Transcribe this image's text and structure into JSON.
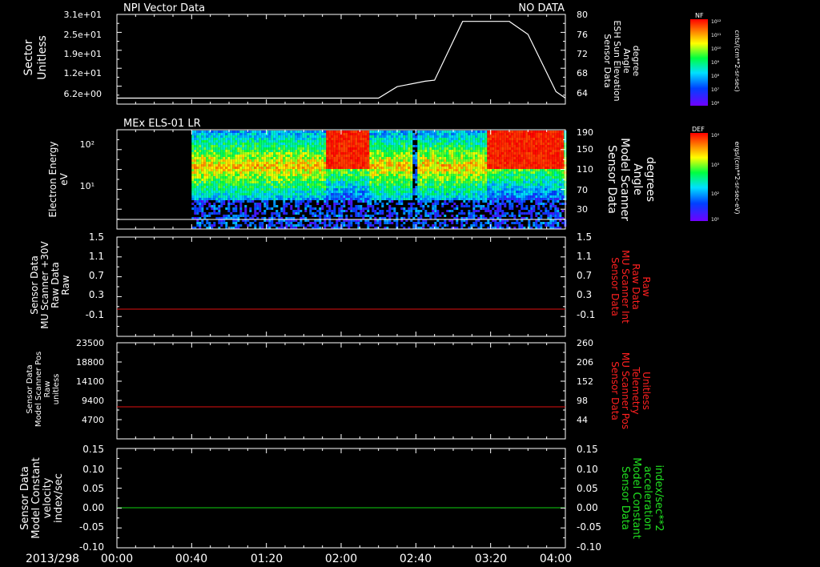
{
  "colors": {
    "axis": "#ffffff",
    "red_trace": "#e01010",
    "green_trace": "#10d010",
    "right_label_red": "#ff2020",
    "right_label_green": "#20e020"
  },
  "time_axis": {
    "start_label": "2013/298",
    "ticks": [
      "00:00",
      "00:40",
      "01:20",
      "02:00",
      "02:40",
      "03:20",
      "04:00"
    ]
  },
  "panels": {
    "p1": {
      "title": "NPI Vector Data",
      "status": "NO DATA",
      "left_label": [
        "Sector",
        "Unitless"
      ],
      "right_label": [
        "Sensor Data",
        "ESH Sun Elevation",
        "Angle",
        "degree"
      ],
      "left_ticks": [
        "3.1e+01",
        "2.5e+01",
        "1.9e+01",
        "1.2e+01",
        "6.2e+00"
      ],
      "right_ticks": [
        "80",
        "76",
        "72",
        "68",
        "64"
      ]
    },
    "p2": {
      "title": "MEx ELS-01 LR",
      "left_label": [
        "Electron Energy",
        "eV"
      ],
      "right_label": [
        "Sensor Data",
        "Model Scanner",
        "Angle",
        "degrees"
      ],
      "left_ticks": [
        "10²",
        "10¹"
      ],
      "right_ticks": [
        "190",
        "150",
        "110",
        "70",
        "30"
      ]
    },
    "p3": {
      "left_label": [
        "Sensor Data",
        "MU Scanner +30V",
        "Raw Data",
        "Raw"
      ],
      "right_label": [
        "Sensor Data",
        "MU Scanner Int",
        "Raw Data",
        "Raw"
      ],
      "left_ticks": [
        "1.5",
        "1.1",
        "0.7",
        "0.3",
        "-0.1"
      ],
      "right_ticks": [
        "1.5",
        "1.1",
        "0.7",
        "0.3",
        "-0.1"
      ]
    },
    "p4": {
      "left_label": [
        "Sensor Data",
        "Model Scanner Pos",
        "Raw",
        "unitless"
      ],
      "right_label": [
        "Sensor Data",
        "MU Scanner Pos",
        "Telemetry",
        "Unitless"
      ],
      "left_ticks": [
        "23500",
        "18800",
        "14100",
        "9400",
        "4700"
      ],
      "right_ticks": [
        "260",
        "206",
        "152",
        "98",
        "44"
      ]
    },
    "p5": {
      "left_label": [
        "Sensor Data",
        "Model Constant",
        "velocity",
        "index/sec"
      ],
      "right_label": [
        "Sensor Data",
        "Model Constant",
        "acceleration",
        "index/sec**2"
      ],
      "left_ticks": [
        "0.15",
        "0.10",
        "0.05",
        "0.00",
        "-0.05",
        "-0.10"
      ],
      "right_ticks": [
        "0.15",
        "0.10",
        "0.05",
        "0.00",
        "-0.05",
        "-0.10"
      ]
    }
  },
  "colorbars": {
    "nf": {
      "title": "NF",
      "unit": "cnts/(cm**2-sr-sec)",
      "ticks": [
        "10¹²",
        "10¹¹",
        "10¹⁰",
        "10⁹",
        "10⁸",
        "10⁷",
        "10⁶"
      ]
    },
    "def": {
      "title": "DEF",
      "unit": "ergs/(cm**2-sr-sec-eV)",
      "ticks": [
        "10⁴",
        "10³",
        "10²",
        "10¹"
      ]
    }
  },
  "chart_data": [
    {
      "type": "line",
      "title": "NPI Vector Data",
      "xlabel": "",
      "ylabel": "Sensor Data ESH Sun Elevation Angle degree",
      "ylim": [
        62,
        80
      ],
      "x": [
        "00:00",
        "01:20",
        "02:20",
        "02:30",
        "02:45",
        "02:50",
        "03:05",
        "03:30",
        "03:40",
        "03:55",
        "04:00"
      ],
      "series": [
        {
          "values": [
            63.2,
            63.2,
            63.2,
            65.5,
            66.6,
            66.8,
            78.6,
            78.6,
            76.0,
            64.5,
            63.2
          ]
        }
      ]
    },
    {
      "type": "heatmap",
      "title": "MEx ELS-01 LR",
      "ylabel": "Electron Energy eV",
      "y_scale": "log",
      "data_start": "00:40",
      "data_end": "04:00",
      "high_flux_intervals": [
        [
          "01:52",
          "02:15"
        ],
        [
          "03:18",
          "03:58"
        ]
      ],
      "gaps": [
        [
          "02:38",
          "02:40"
        ]
      ]
    },
    {
      "type": "line",
      "ylabel": "Sensor Data MU Scanner Int Raw Data Raw",
      "ylim": [
        -0.3,
        1.5
      ],
      "x": [
        "00:00",
        "04:00"
      ],
      "series": [
        {
          "values": [
            0.0,
            0.0
          ]
        }
      ]
    },
    {
      "type": "line",
      "ylabel": "Sensor Data MU Scanner Pos Telemetry Unitless",
      "ylim": [
        0,
        260
      ],
      "x": [
        "00:00",
        "04:00"
      ],
      "series": [
        {
          "values": [
            80,
            80
          ]
        }
      ]
    },
    {
      "type": "line",
      "ylabel": "Sensor Data Model Constant velocity index/sec",
      "ylim": [
        -0.1,
        0.15
      ],
      "x": [
        "00:00",
        "04:00"
      ],
      "series": [
        {
          "values": [
            0.0,
            0.0
          ]
        }
      ]
    }
  ]
}
